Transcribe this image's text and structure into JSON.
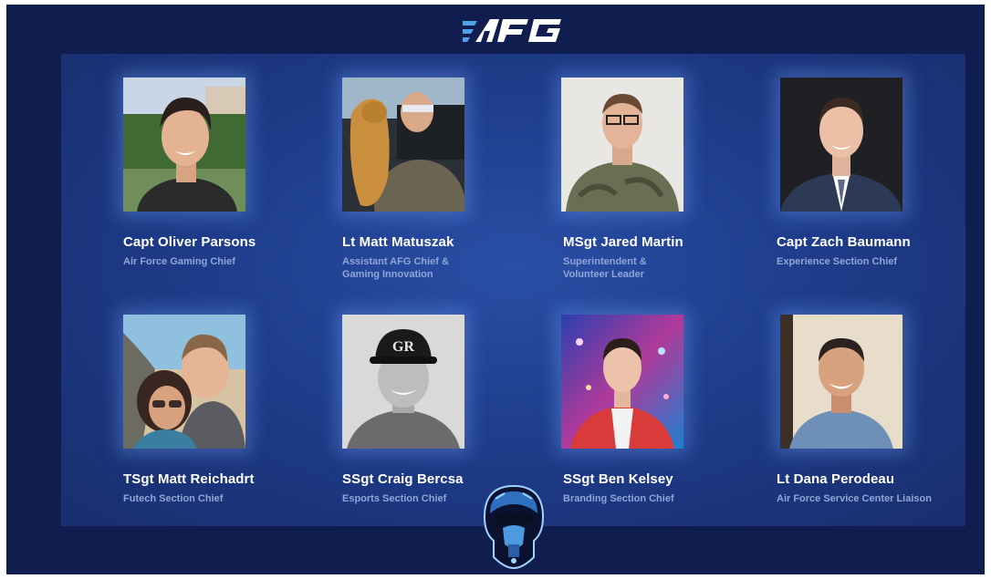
{
  "logo_text": "AFG",
  "colors": {
    "background": "#0f1d4f",
    "panel": "#1f3d8c",
    "name_text": "#ffffff",
    "role_text": "#8fa6d6",
    "logo": "#ffffff",
    "logo_accent": "#4da3e6"
  },
  "members": [
    {
      "name": "Capt Oliver Parsons",
      "role_line1": "Air Force Gaming Chief",
      "role_line2": ""
    },
    {
      "name": "Lt Matt Matuszak",
      "role_line1": "Assistant AFG Chief &",
      "role_line2": "Gaming Innovation"
    },
    {
      "name": "MSgt Jared Martin",
      "role_line1": "Superintendent &",
      "role_line2": "Volunteer Leader"
    },
    {
      "name": "Capt Zach Baumann",
      "role_line1": "Experience Section Chief",
      "role_line2": ""
    },
    {
      "name": "TSgt Matt Reichadrt",
      "role_line1": "Futech Section Chief",
      "role_line2": ""
    },
    {
      "name": "SSgt Craig Bercsa",
      "role_line1": "Esports Section Chief",
      "role_line2": ""
    },
    {
      "name": "SSgt Ben Kelsey",
      "role_line1": "Branding Section Chief",
      "role_line2": ""
    },
    {
      "name": "Lt Dana Perodeau",
      "role_line1": "Air Force Service Center Liaison",
      "role_line2": ""
    }
  ],
  "mascot_icon": "pilot-mask-mascot"
}
